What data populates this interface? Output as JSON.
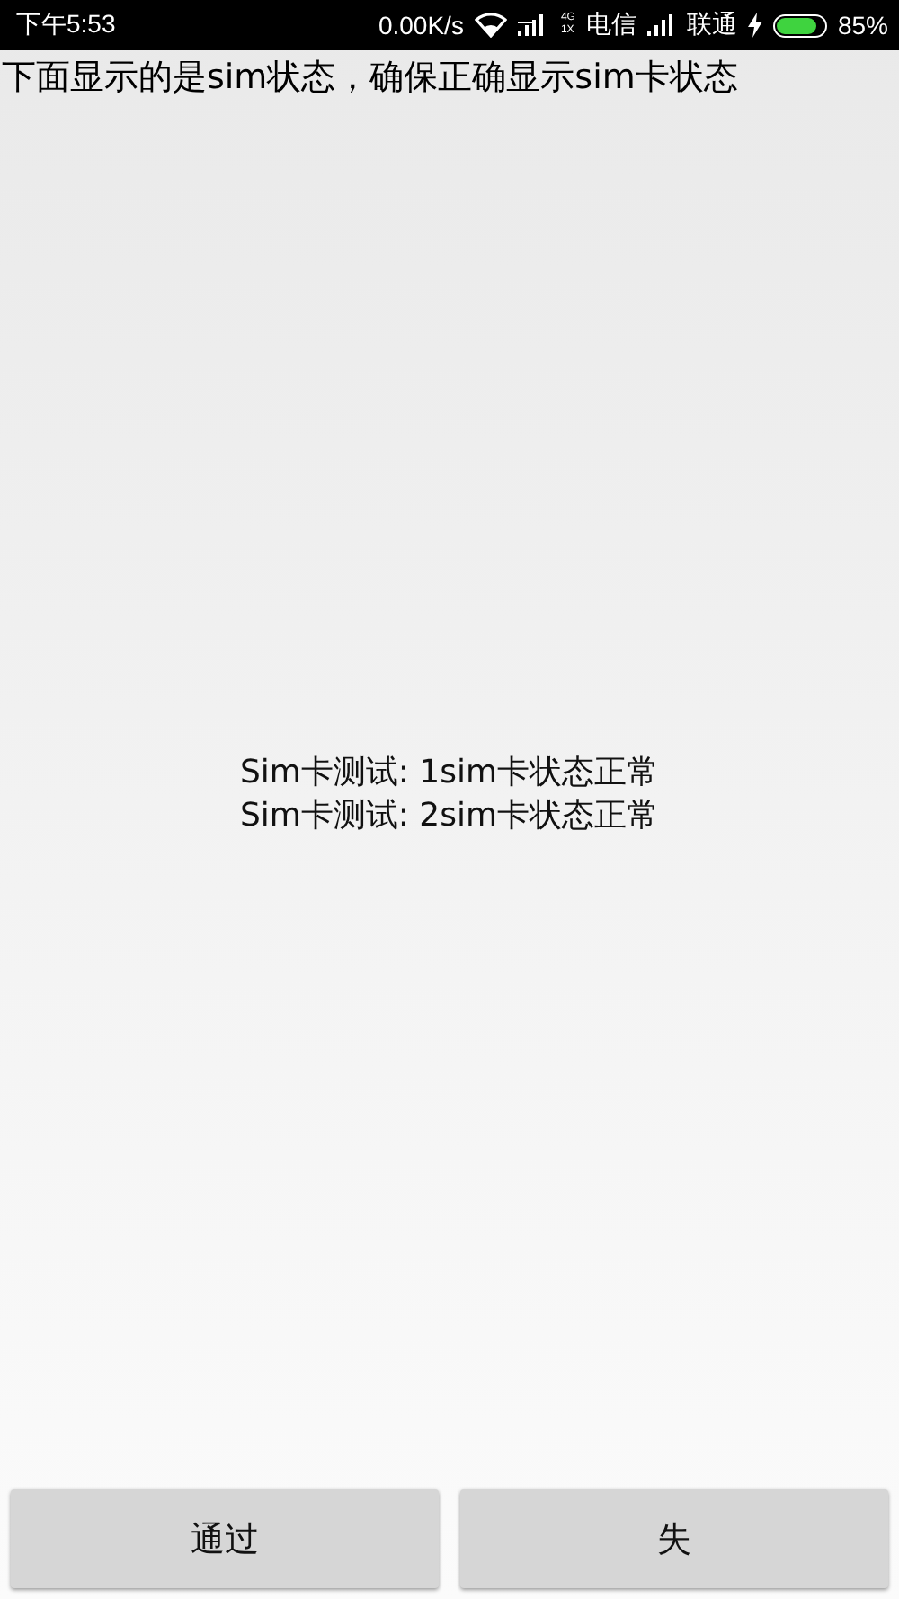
{
  "status_bar": {
    "time": "下午5:53",
    "speed": "0.00K/s",
    "net_top": "4G",
    "net_bottom": "1X",
    "carrier_1": "电信",
    "carrier_2": "联通",
    "charging": true,
    "battery": {
      "level": 0.85
    },
    "battery_text": "85%"
  },
  "header": "下面显示的是sim状态，确保正确显示sim卡状态",
  "results": [
    "Sim卡测试: 1sim卡状态正常",
    "Sim卡测试: 2sim卡状态正常"
  ],
  "buttons": [
    "通过",
    "失"
  ]
}
